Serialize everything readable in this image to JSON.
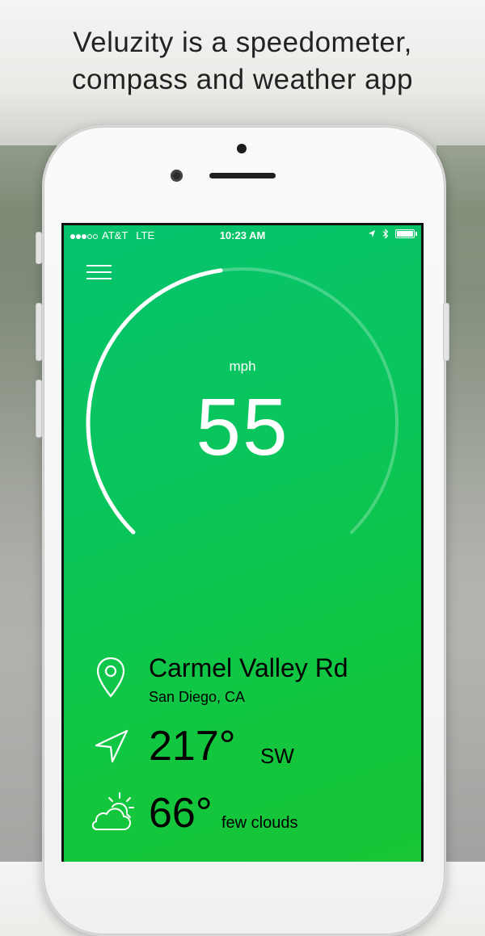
{
  "headline": {
    "line1": "Veluzity is a speedometer,",
    "line2": "compass and weather app"
  },
  "status_bar": {
    "carrier": "AT&T",
    "network": "LTE",
    "time": "10:23 AM",
    "signal_bars_filled": 3,
    "signal_bars_total": 5
  },
  "speedometer": {
    "unit": "mph",
    "speed": "55",
    "gauge_fraction": 0.47
  },
  "location": {
    "street": "Carmel Valley Rd",
    "city": "San Diego, CA"
  },
  "heading": {
    "degrees": "217°",
    "direction": "SW"
  },
  "weather": {
    "temperature": "66°",
    "condition": "few clouds"
  },
  "colors": {
    "screen_green": "#0cc54e",
    "text": "#ffffff"
  },
  "icons": [
    "menu-icon",
    "location-pin-icon",
    "navigation-arrow-icon",
    "partly-cloudy-icon",
    "bluetooth-icon",
    "location-services-icon",
    "battery-icon"
  ]
}
